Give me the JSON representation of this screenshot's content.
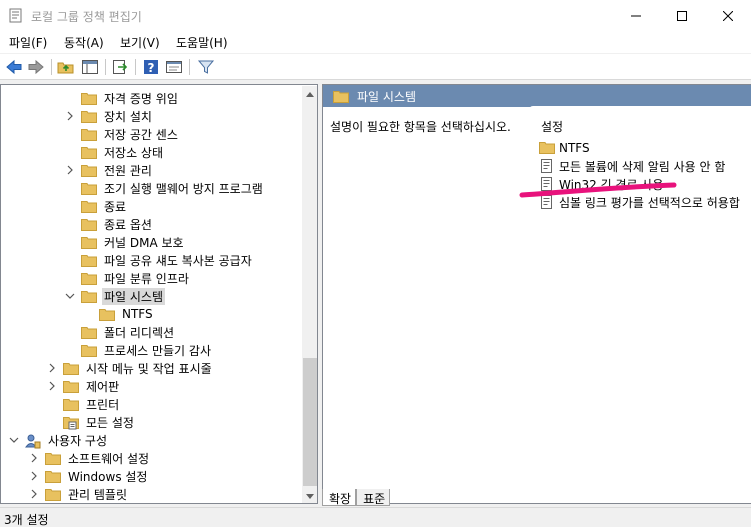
{
  "window": {
    "title": "로컬 그룹 정책 편집기"
  },
  "menu": {
    "file": "파일(F)",
    "action": "동작(A)",
    "view": "보기(V)",
    "help": "도움말(H)"
  },
  "tree": {
    "items": [
      {
        "label": "자격 증명 위임",
        "chevron": "none"
      },
      {
        "label": "장치 설치",
        "chevron": "right"
      },
      {
        "label": "저장 공간 센스",
        "chevron": "none"
      },
      {
        "label": "저장소 상태",
        "chevron": "none"
      },
      {
        "label": "전원 관리",
        "chevron": "right"
      },
      {
        "label": "조기 실행 맬웨어 방지 프로그램",
        "chevron": "none"
      },
      {
        "label": "종료",
        "chevron": "none"
      },
      {
        "label": "종료 옵션",
        "chevron": "none"
      },
      {
        "label": "커널 DMA 보호",
        "chevron": "none"
      },
      {
        "label": "파일 공유 섀도 복사본 공급자",
        "chevron": "none"
      },
      {
        "label": "파일 분류 인프라",
        "chevron": "none"
      },
      {
        "label": "파일 시스템",
        "chevron": "down",
        "selected": true
      },
      {
        "label": "NTFS",
        "chevron": "none"
      },
      {
        "label": "폴더 리디렉션",
        "chevron": "none"
      },
      {
        "label": "프로세스 만들기 감사",
        "chevron": "none"
      },
      {
        "label": "시작 메뉴 및 작업 표시줄",
        "chevron": "right"
      },
      {
        "label": "제어판",
        "chevron": "right"
      },
      {
        "label": "프린터",
        "chevron": "none"
      },
      {
        "label": "모든 설정",
        "chevron": "none",
        "icon": "settings-folder"
      },
      {
        "label": "사용자 구성",
        "chevron": "down",
        "icon": "user-config"
      },
      {
        "label": "소프트웨어 설정",
        "chevron": "right"
      },
      {
        "label": "Windows 설정",
        "chevron": "right"
      },
      {
        "label": "관리 템플릿",
        "chevron": "right"
      }
    ]
  },
  "right_panel": {
    "header": "파일 시스템",
    "description": "설명이 필요한 항목을 선택하십시오.",
    "column_header": "설정",
    "items": [
      {
        "label": "NTFS",
        "icon": "folder"
      },
      {
        "label": "모든 볼륨에 삭제 알림 사용 안 함",
        "icon": "policy"
      },
      {
        "label": "Win32 긴 경로 사용",
        "icon": "policy"
      },
      {
        "label": "심볼 링크 평가를 선택적으로 허용합",
        "icon": "policy"
      }
    ]
  },
  "tabs": {
    "extended": "확장",
    "standard": "표준"
  },
  "status": {
    "text": "3개 설정"
  },
  "colors": {
    "header_bg": "#6b8ab0",
    "folder": "#e8c15f",
    "annotation": "#e8127c"
  }
}
